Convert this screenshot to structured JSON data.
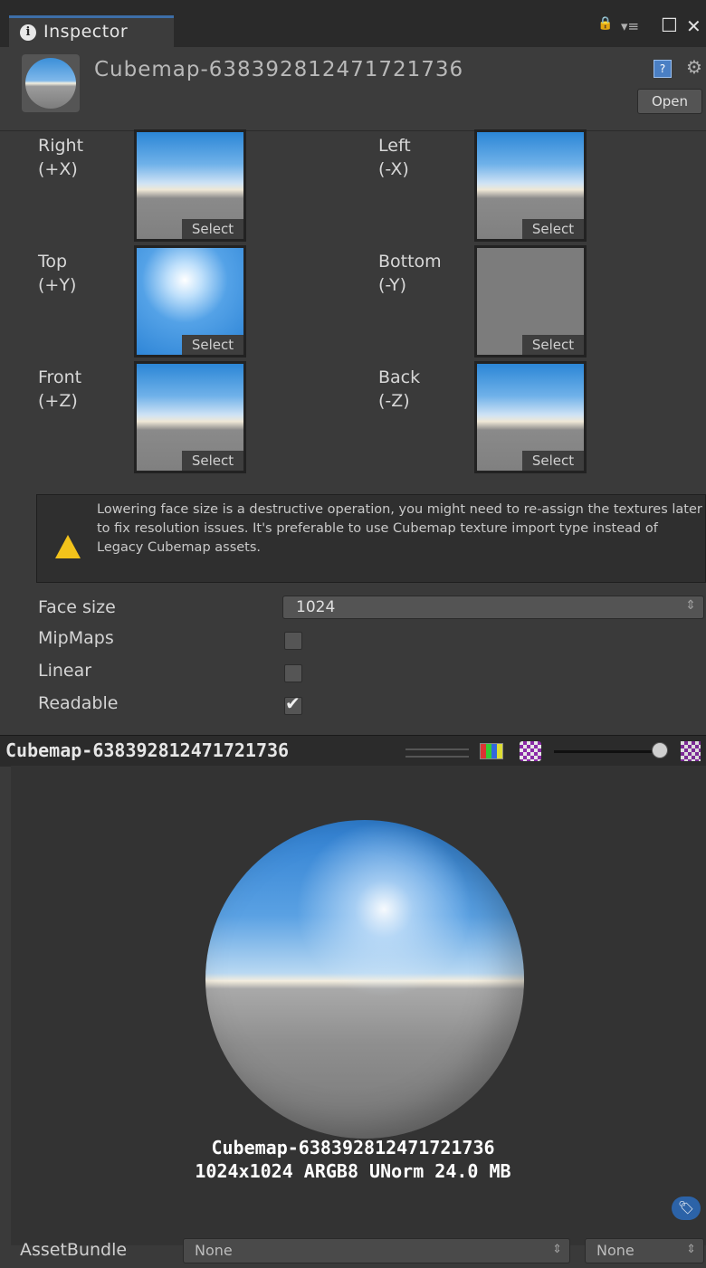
{
  "window": {
    "tab_label": "Inspector",
    "tab_icon_glyph": "i",
    "lock_icon": "🔒",
    "menu_icon": "▾≡",
    "maximize_icon": "☐",
    "close_icon": "✕"
  },
  "header": {
    "asset_name": "Cubemap-638392812471721736",
    "help_glyph": "?",
    "gear_glyph": "⚙",
    "open_label": "Open"
  },
  "faces": [
    {
      "label": "Right\n(+X)",
      "select": "Select"
    },
    {
      "label": "Left\n(-X)",
      "select": "Select"
    },
    {
      "label": "Top\n(+Y)",
      "select": "Select"
    },
    {
      "label": "Bottom\n(-Y)",
      "select": "Select"
    },
    {
      "label": "Front\n(+Z)",
      "select": "Select"
    },
    {
      "label": "Back\n(-Z)",
      "select": "Select"
    }
  ],
  "warning": {
    "text": "Lowering face size is a destructive operation, you might need to re-assign the textures later to fix resolution issues. It's preferable to use Cubemap texture import type instead of Legacy Cubemap assets."
  },
  "properties": {
    "face_size_label": "Face size",
    "face_size_value": "1024",
    "mipmaps_label": "MipMaps",
    "mipmaps_checked": false,
    "linear_label": "Linear",
    "linear_checked": false,
    "readable_label": "Readable",
    "readable_checked": true,
    "check_glyph": "✔",
    "arrow_glyph": "⇕"
  },
  "preview": {
    "title": "Cubemap-638392812471721736",
    "info_name": "Cubemap-638392812471721736",
    "info_details": "1024x1024  ARGB8 UNorm   24.0 MB",
    "label_glyph": "🏷"
  },
  "assetbundle": {
    "label": "AssetBundle",
    "name_value": "None",
    "variant_value": "None"
  },
  "colors": {
    "background": "#3a3a3a",
    "accent": "#3d6ea8",
    "warning": "#f3c31b"
  }
}
